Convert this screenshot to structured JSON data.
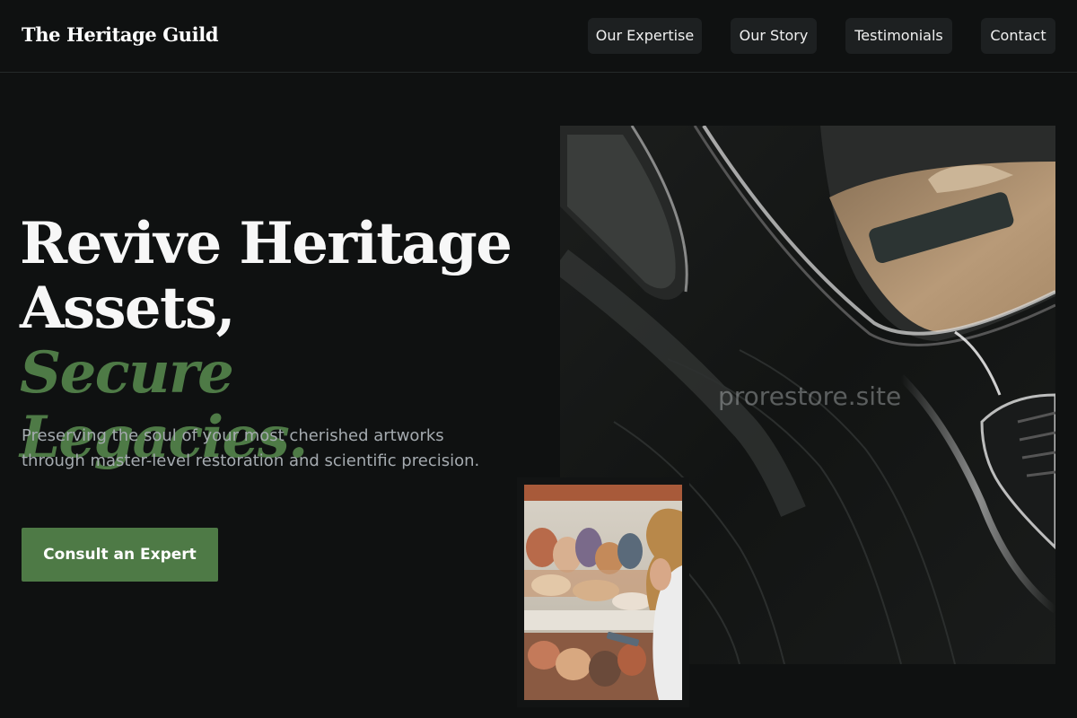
{
  "header": {
    "brand": "The Heritage Guild",
    "nav": [
      {
        "label": "Our Expertise"
      },
      {
        "label": "Our Story"
      },
      {
        "label": "Testimonials"
      },
      {
        "label": "Contact"
      }
    ]
  },
  "hero": {
    "title_line1": "Revive Heritage",
    "title_line2": "Assets,",
    "title_accent": "Secure Legacies.",
    "subtitle": "Preserving the soul of your most cherished artworks through master-level restoration and scientific precision.",
    "cta_label": "Consult an Expert"
  },
  "media": {
    "watermark": "prorestore.site",
    "main_image_alt": "Glossy black classic car body with tan leather interior",
    "inset_image_alt": "Restorer examining a fresco painting"
  },
  "colors": {
    "background": "#0f1111",
    "accent": "#4e7a46",
    "nav_button": "#1d2021",
    "text_muted": "#a5abb0"
  }
}
